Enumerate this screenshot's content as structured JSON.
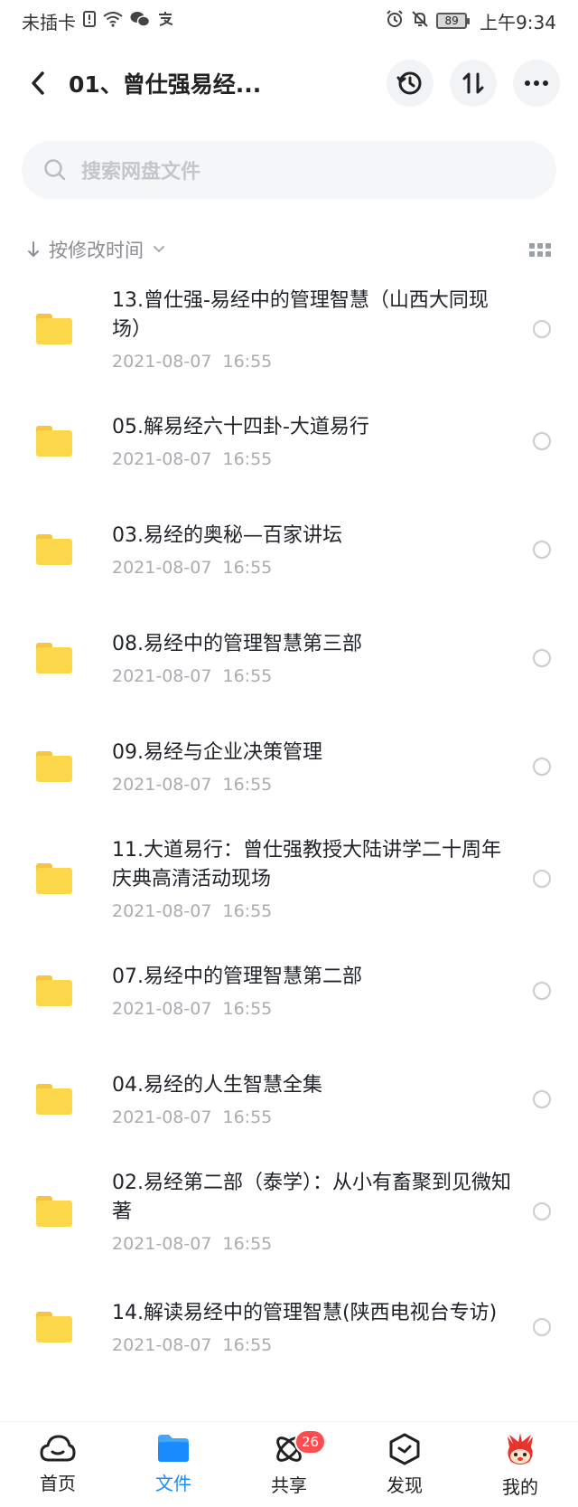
{
  "status_bar": {
    "carrier": "未插卡",
    "battery": "89",
    "time": "上午9:34",
    "icons_left": [
      "sim-alert-icon",
      "wifi-icon",
      "wechat-icon",
      "alipay-icon"
    ],
    "icons_right": [
      "alarm-icon",
      "mute-icon",
      "battery-icon"
    ]
  },
  "header": {
    "title": "01、曾仕强易经..."
  },
  "search": {
    "placeholder": "搜索网盘文件"
  },
  "sort": {
    "label": "按修改时间"
  },
  "files": [
    {
      "name": "13.曾仕强-易经中的管理智慧（山西大同现场）",
      "date": "2021-08-07  16:55",
      "lines": 2
    },
    {
      "name": "05.解易经六十四卦-大道易行",
      "date": "2021-08-07  16:55",
      "lines": 1
    },
    {
      "name": "03.易经的奥秘—百家讲坛",
      "date": "2021-08-07  16:55",
      "lines": 1
    },
    {
      "name": "08.易经中的管理智慧第三部",
      "date": "2021-08-07  16:55",
      "lines": 1
    },
    {
      "name": "09.易经与企业决策管理",
      "date": "2021-08-07  16:55",
      "lines": 1
    },
    {
      "name": "11.大道易行：曾仕强教授大陆讲学二十周年庆典高清活动现场",
      "date": "2021-08-07  16:55",
      "lines": 2
    },
    {
      "name": "07.易经中的管理智慧第二部",
      "date": "2021-08-07  16:55",
      "lines": 1
    },
    {
      "name": "04.易经的人生智慧全集",
      "date": "2021-08-07  16:55",
      "lines": 1
    },
    {
      "name": "02.易经第二部（泰学）：从小有畜聚到见微知著",
      "date": "2021-08-07  16:55",
      "lines": 2
    },
    {
      "name": "14.解读易经中的管理智慧(陕西电视台专访)",
      "date": "2021-08-07  16:55",
      "lines": 2
    }
  ],
  "nav": {
    "items": [
      {
        "label": "首页",
        "icon": "cloud-icon"
      },
      {
        "label": "文件",
        "icon": "folder-icon"
      },
      {
        "label": "共享",
        "icon": "share-orbit-icon",
        "badge": "26"
      },
      {
        "label": "发现",
        "icon": "discover-icon"
      },
      {
        "label": "我的",
        "icon": "avatar-icon"
      }
    ]
  },
  "colors": {
    "accent": "#1a8cff",
    "folder": "#fdd74a",
    "badge": "#ff4d4f"
  }
}
